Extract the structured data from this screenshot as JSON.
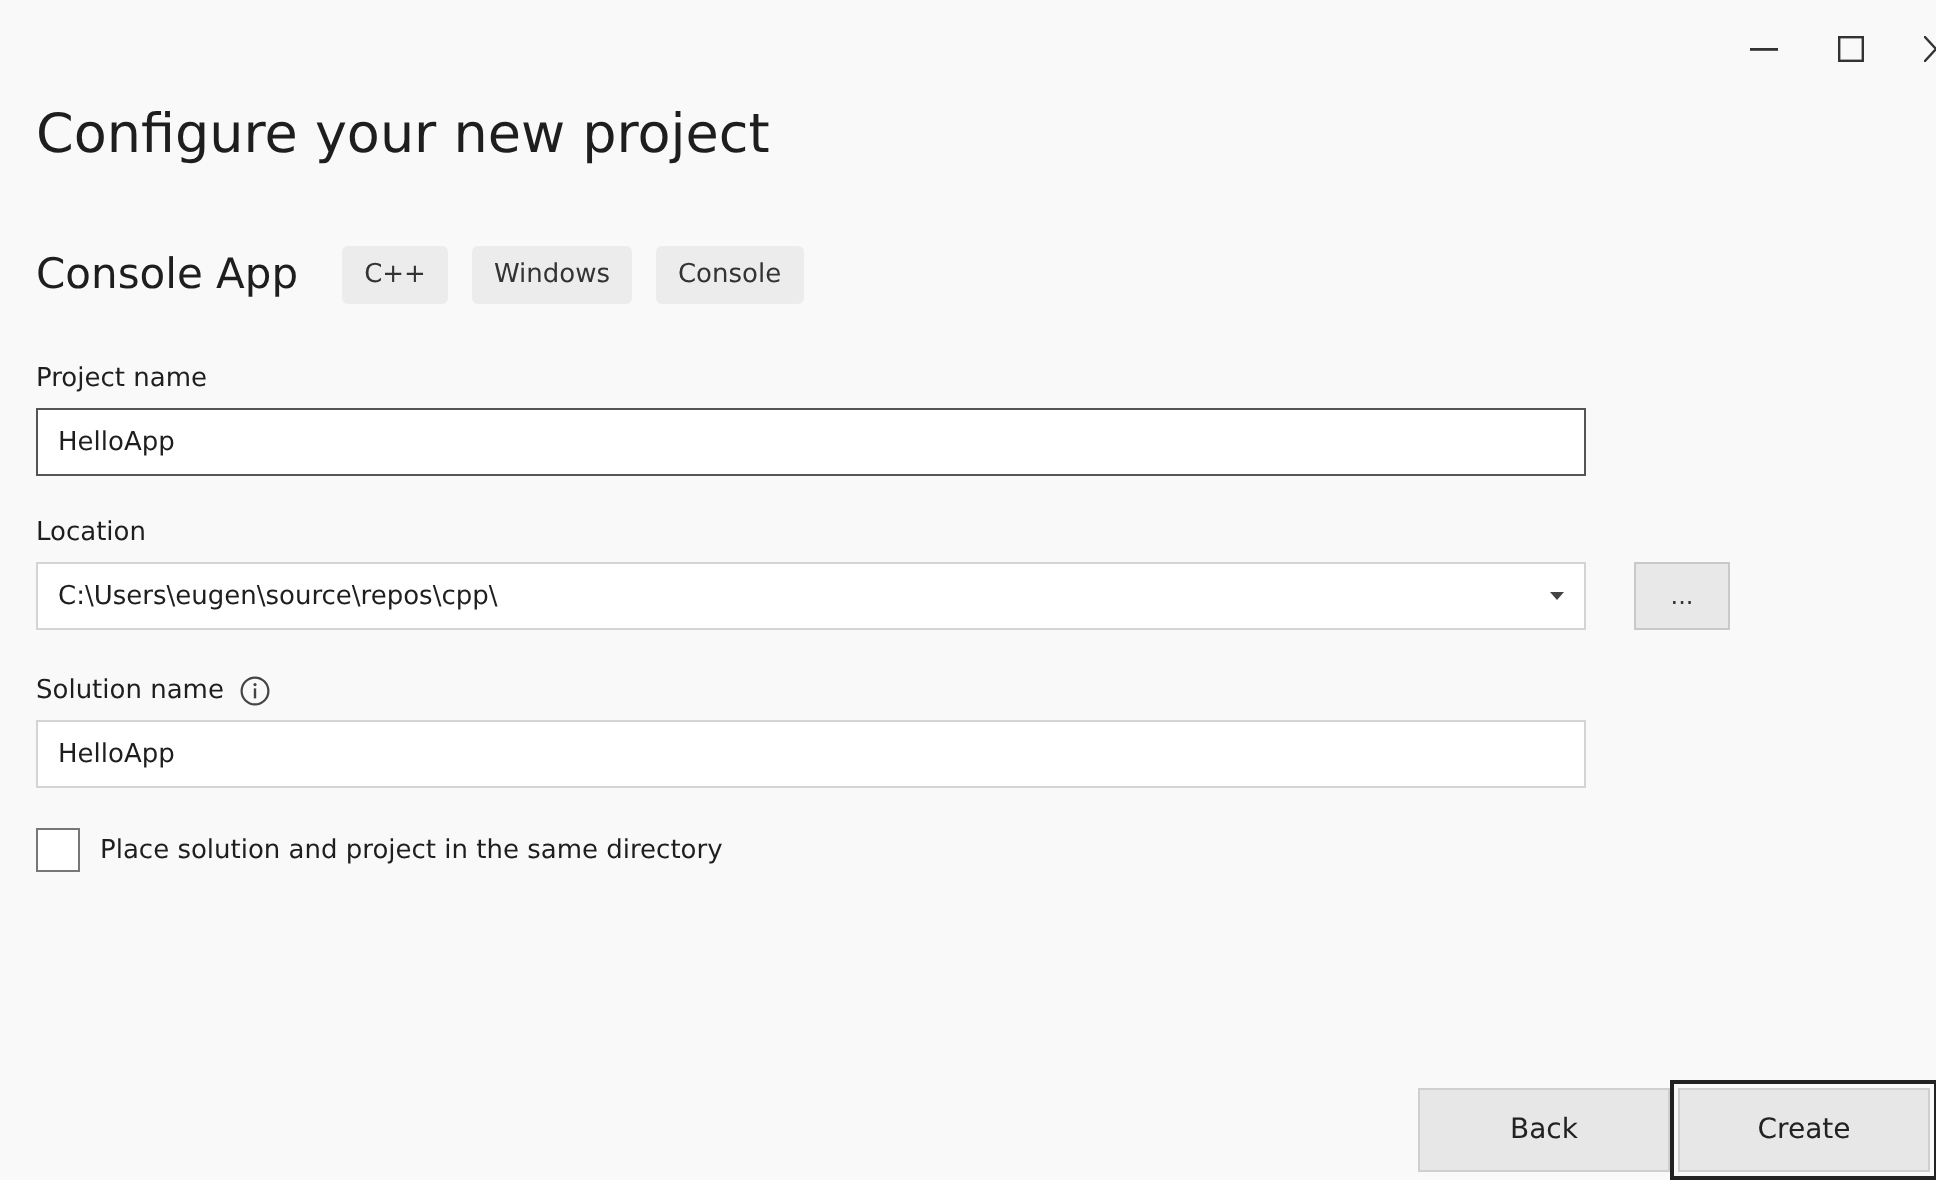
{
  "window": {
    "controls": [
      {
        "kind": "minimize"
      },
      {
        "kind": "maximize"
      },
      {
        "kind": "close"
      }
    ]
  },
  "title": "Configure your new project",
  "template": {
    "name": "Console App",
    "tags": [
      "C++",
      "Windows",
      "Console"
    ]
  },
  "project_name": {
    "label": "Project name",
    "value": "HelloApp",
    "focused": true
  },
  "location": {
    "label": "Location",
    "value": "C:\\Users\\eugen\\source\\repos\\cpp\\",
    "browse": "..."
  },
  "solution_name": {
    "label": "Solution name",
    "value": "HelloApp"
  },
  "same_directory": {
    "label": "Place solution and project in the same directory",
    "checked": false
  },
  "buttons": [
    {
      "label": "Back",
      "focused": false
    },
    {
      "label": "Create",
      "focused": true
    }
  ]
}
